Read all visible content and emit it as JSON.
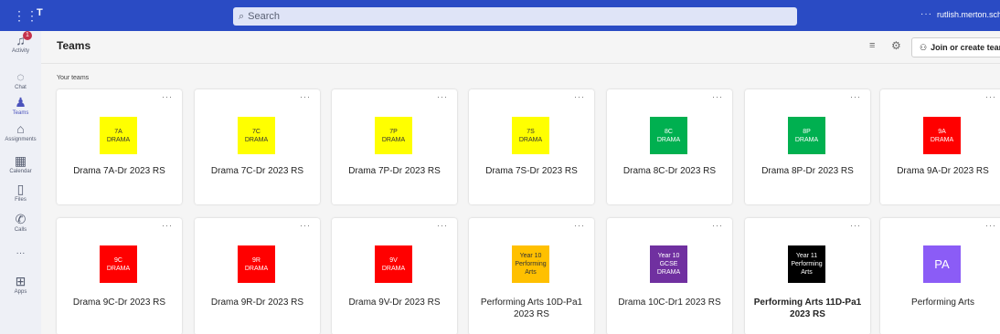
{
  "topbar": {
    "search_placeholder": "Search",
    "more": "···",
    "domain": "rutlish.merton.sch.uk"
  },
  "rail": {
    "activity_badge": "1",
    "items": [
      {
        "label": "Activity",
        "icon": "bell-icon"
      },
      {
        "label": "Chat",
        "icon": "chat-icon"
      },
      {
        "label": "Teams",
        "icon": "teams-icon"
      },
      {
        "label": "Assignments",
        "icon": "assignments-icon"
      },
      {
        "label": "Calendar",
        "icon": "calendar-icon"
      },
      {
        "label": "Files",
        "icon": "file-icon"
      },
      {
        "label": "Calls",
        "icon": "phone-icon"
      },
      {
        "label": "···",
        "icon": "more-icon"
      },
      {
        "label": "Apps",
        "icon": "apps-icon"
      }
    ]
  },
  "header": {
    "title": "Teams",
    "join_label": "Join or create team"
  },
  "section_label": "Your teams",
  "cards": [
    {
      "tile_lines": [
        "7A",
        "DRAMA"
      ],
      "bg": "#ffff00",
      "fg": "#333333",
      "name": "Drama 7A-Dr 2023 RS"
    },
    {
      "tile_lines": [
        "7C",
        "DRAMA"
      ],
      "bg": "#ffff00",
      "fg": "#333333",
      "name": "Drama 7C-Dr 2023 RS"
    },
    {
      "tile_lines": [
        "7P",
        "DRAMA"
      ],
      "bg": "#ffff00",
      "fg": "#333333",
      "name": "Drama 7P-Dr 2023 RS"
    },
    {
      "tile_lines": [
        "7S",
        "DRAMA"
      ],
      "bg": "#ffff00",
      "fg": "#333333",
      "name": "Drama 7S-Dr 2023 RS"
    },
    {
      "tile_lines": [
        "8C",
        "DRAMA"
      ],
      "bg": "#00b050",
      "fg": "#ffffff",
      "name": "Drama 8C-Dr 2023 RS"
    },
    {
      "tile_lines": [
        "8P",
        "DRAMA"
      ],
      "bg": "#00b050",
      "fg": "#ffffff",
      "name": "Drama 8P-Dr 2023 RS"
    },
    {
      "tile_lines": [
        "9A",
        "DRAMA"
      ],
      "bg": "#ff0000",
      "fg": "#ffffff",
      "name": "Drama 9A-Dr 2023 RS"
    },
    {
      "tile_lines": [
        "9C",
        "DRAMA"
      ],
      "bg": "#ff0000",
      "fg": "#ffffff",
      "name": "Drama 9C-Dr 2023 RS"
    },
    {
      "tile_lines": [
        "9R",
        "DRAMA"
      ],
      "bg": "#ff0000",
      "fg": "#ffffff",
      "name": "Drama 9R-Dr 2023 RS"
    },
    {
      "tile_lines": [
        "9V",
        "DRAMA"
      ],
      "bg": "#ff0000",
      "fg": "#ffffff",
      "name": "Drama 9V-Dr 2023 RS"
    },
    {
      "tile_lines": [
        "Year 10",
        "Performing",
        "Arts"
      ],
      "bg": "#ffc000",
      "fg": "#333333",
      "name": "Performing Arts 10D-Pa1 2023 RS"
    },
    {
      "tile_lines": [
        "Year 10",
        "GCSE",
        "DRAMA"
      ],
      "bg": "#7030a0",
      "fg": "#ffffff",
      "name": "Drama 10C-Dr1 2023 RS"
    },
    {
      "tile_lines": [
        "Year 11",
        "Performing",
        "Arts"
      ],
      "bg": "#000000",
      "fg": "#ffffff",
      "name": "Performing Arts 11D-Pa1 2023 RS",
      "bold": true
    },
    {
      "tile_lines": [
        "PA"
      ],
      "bg": "#8b5cf6",
      "fg": "#ffffff",
      "name": "Performing Arts",
      "pa": true
    }
  ]
}
